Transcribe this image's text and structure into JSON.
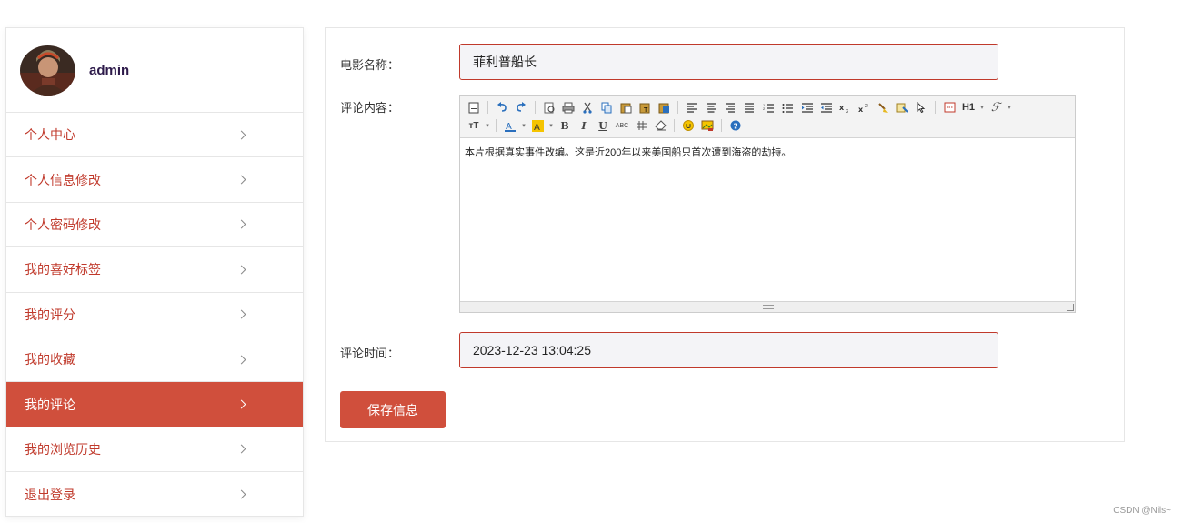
{
  "user": {
    "name": "admin"
  },
  "sidebar": {
    "items": [
      {
        "label": "个人中心"
      },
      {
        "label": "个人信息修改"
      },
      {
        "label": "个人密码修改"
      },
      {
        "label": "我的喜好标签"
      },
      {
        "label": "我的评分"
      },
      {
        "label": "我的收藏"
      },
      {
        "label": "我的评论",
        "active": true
      },
      {
        "label": "我的浏览历史"
      },
      {
        "label": "退出登录"
      }
    ]
  },
  "form": {
    "movie_name_label": "电影名称：",
    "movie_name_value": "菲利普船长",
    "comment_content_label": "评论内容：",
    "comment_content_value": "本片根据真实事件改编。这是近200年以来美国船只首次遭到海盗的劫持。",
    "comment_time_label": "评论时间：",
    "comment_time_value": "2023-12-23 13:04:25",
    "save_label": "保存信息"
  },
  "editor_toolbar": {
    "heading_label": "H1",
    "fontsize_label": "тT",
    "bold": "B",
    "italic": "I",
    "underline": "U",
    "strike": "ABC"
  },
  "colors": {
    "accent": "#d04f3c",
    "input_border": "#c0392b",
    "menu_text": "#c0392b"
  },
  "watermark": "CSDN @Nils~"
}
